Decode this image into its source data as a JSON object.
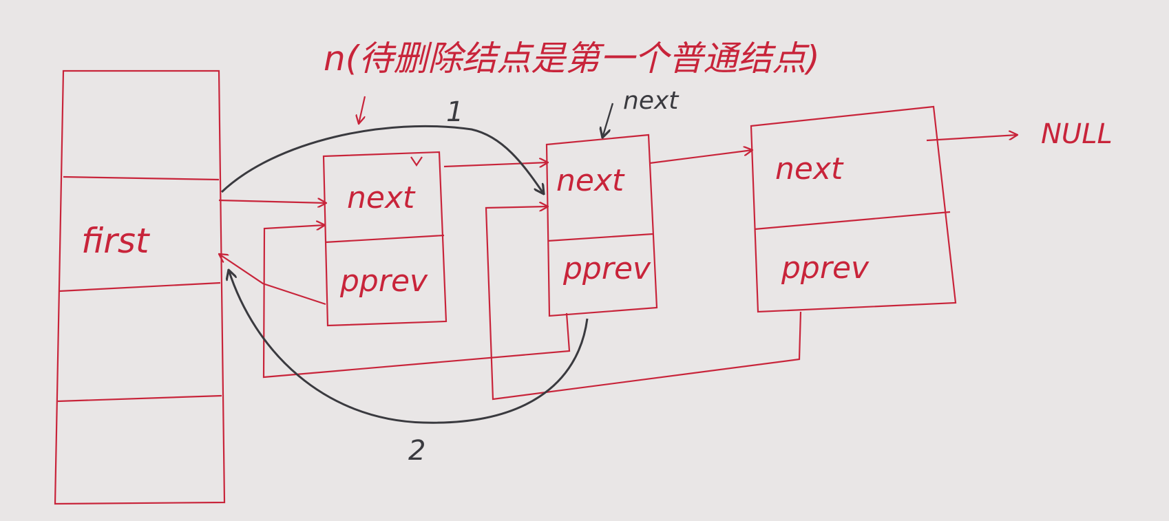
{
  "diagram": {
    "title": "n(待删除结点是第一个普通结点)",
    "first_label": "first",
    "nodes": [
      {
        "field_top": "next",
        "field_bottom": "pprev"
      },
      {
        "field_top": "next",
        "field_bottom": "pprev"
      },
      {
        "field_top": "next",
        "field_bottom": "pprev"
      }
    ],
    "next_pointer_label": "next",
    "null_label": "NULL",
    "step_labels": [
      "1",
      "2"
    ],
    "colors": {
      "paper": "#e9e6e6",
      "ink_red": "#c8243a",
      "ink_dark": "#3a3a3f"
    }
  }
}
